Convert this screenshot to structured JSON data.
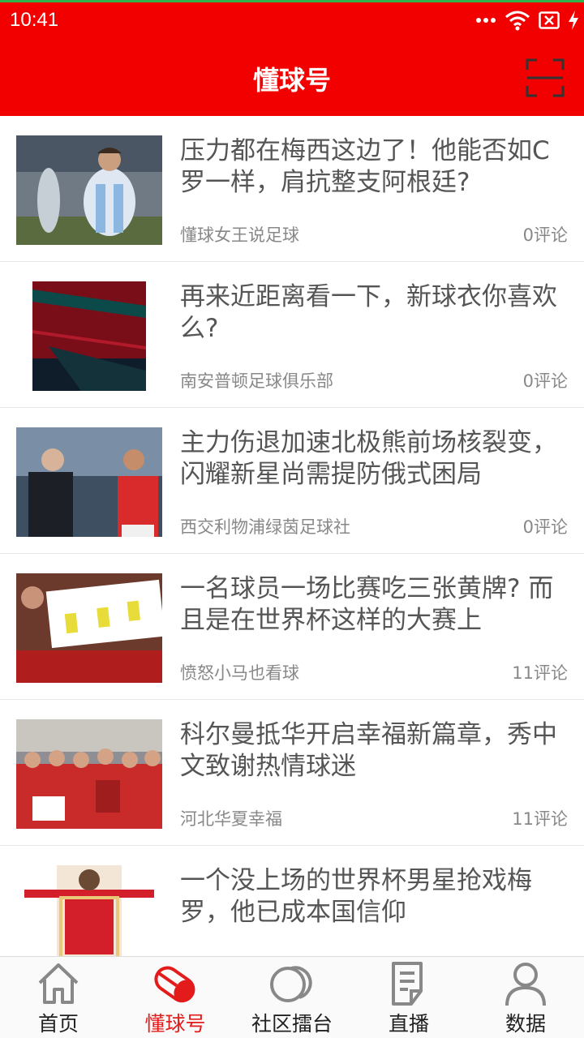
{
  "status_bar": {
    "time": "10:41"
  },
  "header": {
    "title": "懂球号",
    "scan_icon": "scan-icon"
  },
  "feed": [
    {
      "title": "压力都在梅西这边了！他能否如C罗一样，肩抗整支阿根廷?",
      "source": "懂球女王说足球",
      "comments": "0评论"
    },
    {
      "title": "再来近距离看一下，新球衣你喜欢么?",
      "source": "南安普顿足球俱乐部",
      "comments": "0评论"
    },
    {
      "title": "主力伤退加速北极熊前场核裂变，闪耀新星尚需提防俄式困局",
      "source": "西交利物浦绿茵足球社",
      "comments": "0评论"
    },
    {
      "title": "一名球员一场比赛吃三张黄牌? 而且是在世界杯这样的大赛上",
      "source": "愤怒小马也看球",
      "comments": "11评论"
    },
    {
      "title": "科尔曼抵华开启幸福新篇章，秀中文致谢热情球迷",
      "source": "河北华夏幸福",
      "comments": "11评论"
    },
    {
      "title": "一个没上场的世界杯男星抢戏梅罗，他已成本国信仰",
      "source": "",
      "comments": ""
    }
  ],
  "tabs": [
    {
      "label": "首页",
      "icon": "home-icon",
      "active": false
    },
    {
      "label": "懂球号",
      "icon": "dongqiu-icon",
      "active": true
    },
    {
      "label": "社区擂台",
      "icon": "community-icon",
      "active": false
    },
    {
      "label": "直播",
      "icon": "live-icon",
      "active": false
    },
    {
      "label": "数据",
      "icon": "profile-icon",
      "active": false
    }
  ],
  "colors": {
    "brand_red": "#f20000",
    "active_tab": "#e41b1b",
    "text_gray": "#555555"
  }
}
